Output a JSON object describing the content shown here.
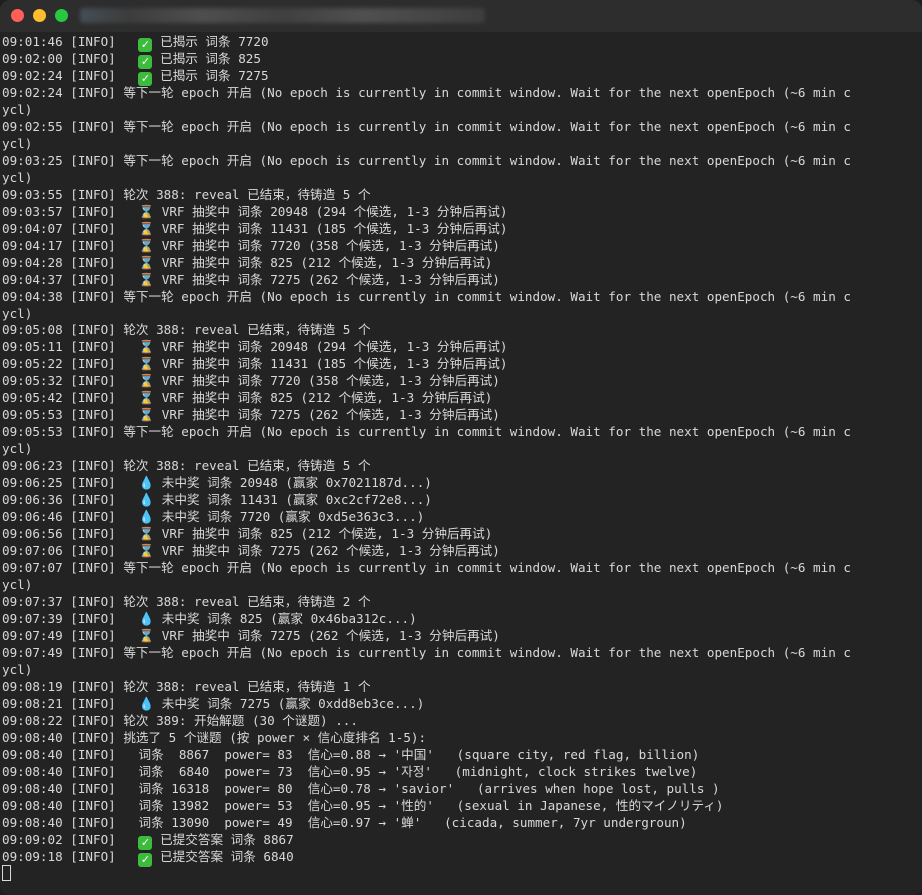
{
  "window": {
    "title": ""
  },
  "lines": [
    {
      "pre": "09:01:46 [INFO]   ",
      "icon": "check",
      "post": " 已揭示 词条 7720"
    },
    {
      "pre": "09:02:00 [INFO]   ",
      "icon": "check",
      "post": " 已揭示 词条 825"
    },
    {
      "pre": "09:02:24 [INFO]   ",
      "icon": "check",
      "post": " 已揭示 词条 7275"
    },
    {
      "pre": "09:02:24 [INFO] 等下一轮 epoch 开启 (No epoch is currently in commit window. Wait for the next openEpoch (~6 min c",
      "icon": "",
      "post": ""
    },
    {
      "pre": "ycl)",
      "icon": "",
      "post": ""
    },
    {
      "pre": "09:02:55 [INFO] 等下一轮 epoch 开启 (No epoch is currently in commit window. Wait for the next openEpoch (~6 min c",
      "icon": "",
      "post": ""
    },
    {
      "pre": "ycl)",
      "icon": "",
      "post": ""
    },
    {
      "pre": "09:03:25 [INFO] 等下一轮 epoch 开启 (No epoch is currently in commit window. Wait for the next openEpoch (~6 min c",
      "icon": "",
      "post": ""
    },
    {
      "pre": "ycl)",
      "icon": "",
      "post": ""
    },
    {
      "pre": "09:03:55 [INFO] 轮次 388: reveal 已结束，待铸造 5 个",
      "icon": "",
      "post": ""
    },
    {
      "pre": "09:03:57 [INFO]   ",
      "icon": "hourglass",
      "post": " VRF 抽奖中 词条 20948 (294 个候选, 1-3 分钟后再试)"
    },
    {
      "pre": "09:04:07 [INFO]   ",
      "icon": "hourglass",
      "post": " VRF 抽奖中 词条 11431 (185 个候选, 1-3 分钟后再试)"
    },
    {
      "pre": "09:04:17 [INFO]   ",
      "icon": "hourglass",
      "post": " VRF 抽奖中 词条 7720 (358 个候选, 1-3 分钟后再试)"
    },
    {
      "pre": "09:04:28 [INFO]   ",
      "icon": "hourglass",
      "post": " VRF 抽奖中 词条 825 (212 个候选, 1-3 分钟后再试)"
    },
    {
      "pre": "09:04:37 [INFO]   ",
      "icon": "hourglass",
      "post": " VRF 抽奖中 词条 7275 (262 个候选, 1-3 分钟后再试)"
    },
    {
      "pre": "09:04:38 [INFO] 等下一轮 epoch 开启 (No epoch is currently in commit window. Wait for the next openEpoch (~6 min c",
      "icon": "",
      "post": ""
    },
    {
      "pre": "ycl)",
      "icon": "",
      "post": ""
    },
    {
      "pre": "09:05:08 [INFO] 轮次 388: reveal 已结束，待铸造 5 个",
      "icon": "",
      "post": ""
    },
    {
      "pre": "09:05:11 [INFO]   ",
      "icon": "hourglass",
      "post": " VRF 抽奖中 词条 20948 (294 个候选, 1-3 分钟后再试)"
    },
    {
      "pre": "09:05:22 [INFO]   ",
      "icon": "hourglass",
      "post": " VRF 抽奖中 词条 11431 (185 个候选, 1-3 分钟后再试)"
    },
    {
      "pre": "09:05:32 [INFO]   ",
      "icon": "hourglass",
      "post": " VRF 抽奖中 词条 7720 (358 个候选, 1-3 分钟后再试)"
    },
    {
      "pre": "09:05:42 [INFO]   ",
      "icon": "hourglass",
      "post": " VRF 抽奖中 词条 825 (212 个候选, 1-3 分钟后再试)"
    },
    {
      "pre": "09:05:53 [INFO]   ",
      "icon": "hourglass",
      "post": " VRF 抽奖中 词条 7275 (262 个候选, 1-3 分钟后再试)"
    },
    {
      "pre": "09:05:53 [INFO] 等下一轮 epoch 开启 (No epoch is currently in commit window. Wait for the next openEpoch (~6 min c",
      "icon": "",
      "post": ""
    },
    {
      "pre": "ycl)",
      "icon": "",
      "post": ""
    },
    {
      "pre": "09:06:23 [INFO] 轮次 388: reveal 已结束，待铸造 5 个",
      "icon": "",
      "post": ""
    },
    {
      "pre": "09:06:25 [INFO]   ",
      "icon": "droplet",
      "post": " 未中奖 词条 20948 (赢家 0x7021187d...)"
    },
    {
      "pre": "09:06:36 [INFO]   ",
      "icon": "droplet",
      "post": " 未中奖 词条 11431 (赢家 0xc2cf72e8...)"
    },
    {
      "pre": "09:06:46 [INFO]   ",
      "icon": "droplet",
      "post": " 未中奖 词条 7720 (赢家 0xd5e363c3...)"
    },
    {
      "pre": "09:06:56 [INFO]   ",
      "icon": "hourglass",
      "post": " VRF 抽奖中 词条 825 (212 个候选, 1-3 分钟后再试)"
    },
    {
      "pre": "09:07:06 [INFO]   ",
      "icon": "hourglass",
      "post": " VRF 抽奖中 词条 7275 (262 个候选, 1-3 分钟后再试)"
    },
    {
      "pre": "09:07:07 [INFO] 等下一轮 epoch 开启 (No epoch is currently in commit window. Wait for the next openEpoch (~6 min c",
      "icon": "",
      "post": ""
    },
    {
      "pre": "ycl)",
      "icon": "",
      "post": ""
    },
    {
      "pre": "09:07:37 [INFO] 轮次 388: reveal 已结束，待铸造 2 个",
      "icon": "",
      "post": ""
    },
    {
      "pre": "09:07:39 [INFO]   ",
      "icon": "droplet",
      "post": " 未中奖 词条 825 (赢家 0x46ba312c...)"
    },
    {
      "pre": "09:07:49 [INFO]   ",
      "icon": "hourglass",
      "post": " VRF 抽奖中 词条 7275 (262 个候选, 1-3 分钟后再试)"
    },
    {
      "pre": "09:07:49 [INFO] 等下一轮 epoch 开启 (No epoch is currently in commit window. Wait for the next openEpoch (~6 min c",
      "icon": "",
      "post": ""
    },
    {
      "pre": "ycl)",
      "icon": "",
      "post": ""
    },
    {
      "pre": "09:08:19 [INFO] 轮次 388: reveal 已结束，待铸造 1 个",
      "icon": "",
      "post": ""
    },
    {
      "pre": "09:08:21 [INFO]   ",
      "icon": "droplet",
      "post": " 未中奖 词条 7275 (赢家 0xdd8eb3ce...)"
    },
    {
      "pre": "09:08:22 [INFO] 轮次 389: 开始解题 (30 个谜题) ...",
      "icon": "",
      "post": ""
    },
    {
      "pre": "09:08:40 [INFO] 挑选了 5 个谜题 (按 power × 信心度排名 1-5):",
      "icon": "",
      "post": ""
    },
    {
      "pre": "09:08:40 [INFO]   词条  8867  power= 83  信心=0.88 → '中国'   (square city, red flag, billion)",
      "icon": "",
      "post": ""
    },
    {
      "pre": "09:08:40 [INFO]   词条  6840  power= 73  信心=0.95 → '자정'   (midnight, clock strikes twelve)",
      "icon": "",
      "post": ""
    },
    {
      "pre": "09:08:40 [INFO]   词条 16318  power= 80  信心=0.78 → 'savior'   (arrives when hope lost, pulls )",
      "icon": "",
      "post": ""
    },
    {
      "pre": "09:08:40 [INFO]   词条 13982  power= 53  信心=0.95 → '性的'   (sexual in Japanese, 性的マイノリティ)",
      "icon": "",
      "post": ""
    },
    {
      "pre": "09:08:40 [INFO]   词条 13090  power= 49  信心=0.97 → '蝉'   (cicada, summer, 7yr undergroun)",
      "icon": "",
      "post": ""
    },
    {
      "pre": "09:09:02 [INFO]   ",
      "icon": "check",
      "post": " 已提交答案 词条 8867"
    },
    {
      "pre": "09:09:18 [INFO]   ",
      "icon": "check",
      "post": " 已提交答案 词条 6840"
    }
  ],
  "icons": {
    "check": "✓",
    "hourglass": "⌛",
    "droplet": "💧"
  }
}
